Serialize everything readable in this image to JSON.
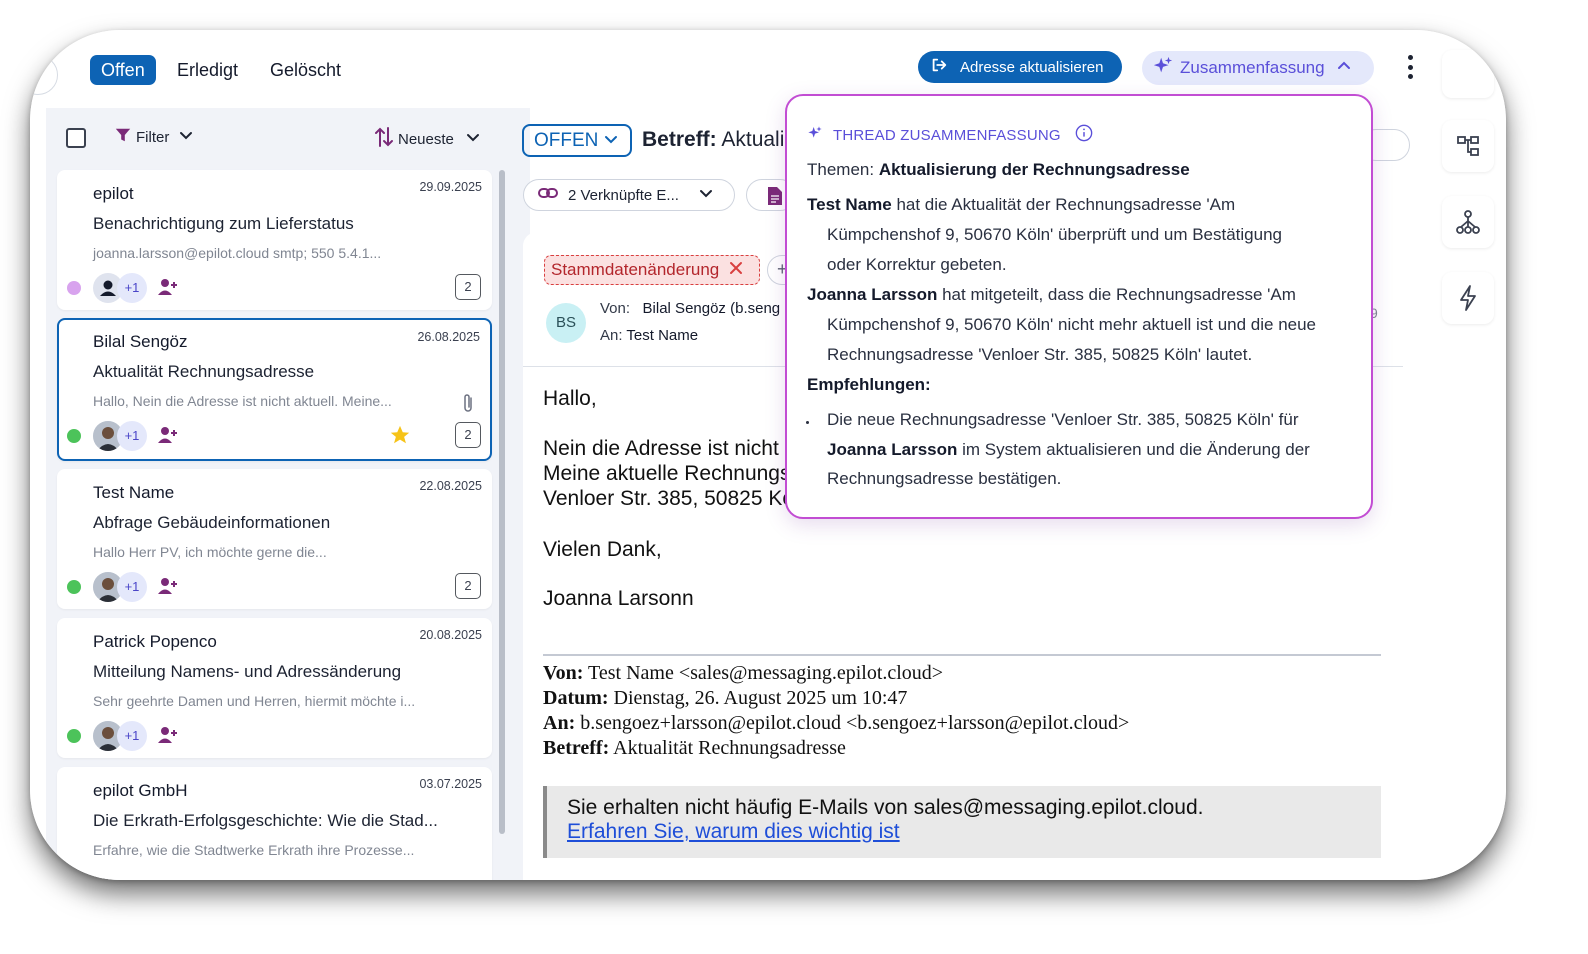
{
  "tabs": [
    "Offen",
    "Erledigt",
    "Gelöscht"
  ],
  "header": {
    "address_button": "Adresse aktualisieren",
    "summary_button": "Zusammenfassung"
  },
  "list": {
    "filter_label": "Filter",
    "sort_label": "Neueste",
    "items": [
      {
        "sender": "epilot",
        "date": "29.09.2025",
        "subject": "Benachrichtigung zum Lieferstatus",
        "preview": "joanna.larsson@epilot.cloud smtp; 550 5.4.1...",
        "extra": "+1",
        "count": "2",
        "dot_color": "#d8a3ee"
      },
      {
        "sender": "Bilal Sengöz",
        "date": "26.08.2025",
        "subject": "Aktualität Rechnungsadresse",
        "preview": "Hallo, Nein die Adresse ist nicht aktuell. Meine...",
        "extra": "+1",
        "count": "2",
        "dot_color": "#4cc35a"
      },
      {
        "sender": "Test Name",
        "date": "22.08.2025",
        "subject": "Abfrage Gebäudeinformationen",
        "preview": "Hallo Herr PV, ich möchte gerne die...",
        "extra": "+1",
        "count": "2",
        "dot_color": "#4cc35a"
      },
      {
        "sender": "Patrick Popenco",
        "date": "20.08.2025",
        "subject": "Mitteilung Namens- und Adressänderung",
        "preview": "Sehr geehrte Damen und Herren, hiermit möchte i...",
        "extra": "+1",
        "dot_color": "#4cc35a"
      },
      {
        "sender": "epilot GmbH",
        "date": "03.07.2025",
        "subject": "Die Erkrath-Erfolgsgeschichte: Wie die Stad...",
        "preview": "Erfahre, wie die Stadtwerke Erkrath ihre Prozesse..."
      }
    ]
  },
  "thread": {
    "status": "OFFEN",
    "subject_label": "Betreff:",
    "subject_value": "Aktuali",
    "linked": "2 Verknüpfte E...",
    "tag": "Stammdatenänderung",
    "from_label": "Von:",
    "from_value": "Bilal Sengöz (b.seng",
    "to_label": "An:",
    "to_value": "Test Name",
    "avatar": "BS",
    "side_digit": "9",
    "body_lines": [
      "Hallo,",
      "Nein die Adresse ist nicht a",
      "Meine aktuelle Rechnungs",
      "Venloer Str. 385, 50825 Kö",
      "Vielen Dank,",
      "Joanna Larsonn"
    ],
    "quoted": {
      "from_label": "Von:",
      "from_value": "Test Name <sales@messaging.epilot.cloud>",
      "date_label": "Datum:",
      "date_value": "Dienstag, 26. August 2025 um 10:47",
      "to_label": "An:",
      "to_value": "b.sengoez+larsson@epilot.cloud <b.sengoez+larsson@epilot.cloud>",
      "subject_label": "Betreff:",
      "subject_value": "Aktualität Rechnungsadresse"
    },
    "notice_text": "Sie erhalten nicht häufig E-Mails von sales@messaging.epilot.cloud.",
    "notice_link": "Erfahren Sie, warum dies wichtig ist"
  },
  "summary": {
    "title": "THREAD ZUSAMMENFASSUNG",
    "topics_label": "Themen:",
    "topics_value": "Aktualisierung der Rechnungsadresse",
    "p1_name": "Test Name",
    "p1_line1": " hat die Aktualität der Rechnungsadresse 'Am",
    "p1_line2": "Kümpchenshof 9, 50670 Köln' überprüft und um Bestätigung",
    "p1_line3": "oder Korrektur gebeten.",
    "p2_name": "Joanna Larsson",
    "p2_line1": " hat mitgeteilt, dass die Rechnungsadresse 'Am",
    "p2_line2": "Kümpchenshof 9, 50670 Köln' nicht mehr aktuell ist und die neue",
    "p2_line3": "Rechnungsadresse 'Venloer Str. 385, 50825 Köln' lautet.",
    "rec_label": "Empfehlungen:",
    "rec_line1": "Die neue Rechnungsadresse 'Venloer Str. 385, 50825 Köln' für",
    "rec_name": "Joanna Larsson",
    "rec_line2": " im System aktualisieren und die Änderung der",
    "rec_line3": "Rechnungsadresse bestätigen."
  },
  "colors": {
    "primary": "#0d63b4",
    "summary_accent": "#5a4fd9",
    "popover_border": "#c24dd3",
    "tag_red": "#d94040"
  },
  "icons": [
    "logout-icon",
    "sparkle-icon",
    "chevron-up-icon",
    "more-vertical-icon",
    "filter-icon",
    "sort-icon",
    "chevron-down-icon",
    "link-icon",
    "document-icon",
    "close-icon",
    "plus-icon",
    "person-icon",
    "assign-user-icon",
    "star-icon",
    "paperclip-icon",
    "info-icon",
    "hierarchy-icon",
    "workflow-icon",
    "lightning-icon"
  ]
}
